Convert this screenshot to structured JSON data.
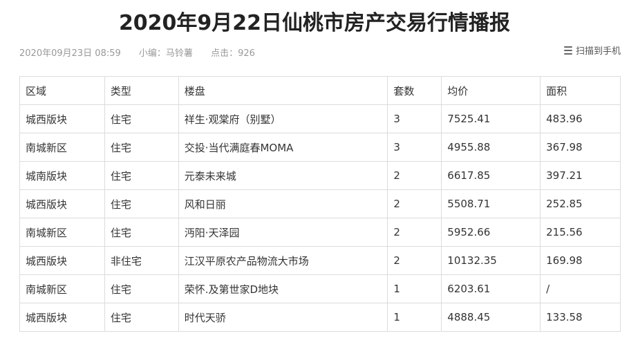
{
  "article": {
    "title": "2020年9月22日仙桃市房产交易行情播报",
    "date": "2020年09月23日 08:59",
    "editor": "小编：马铃薯",
    "clicks": "点击：926",
    "scan_label": "扫描到手机",
    "scan_icon": "qr-scan-icon"
  },
  "table": {
    "headers": [
      "区域",
      "类型",
      "楼盘",
      "套数",
      "均价",
      "面积"
    ],
    "rows": [
      [
        "城西版块",
        "住宅",
        "祥生·观棠府（别墅）",
        "3",
        "7525.41",
        "483.96"
      ],
      [
        "南城新区",
        "住宅",
        "交投·当代满庭春MOMA",
        "3",
        "4955.88",
        "367.98"
      ],
      [
        "城南版块",
        "住宅",
        "元泰未来城",
        "2",
        "6617.85",
        "397.21"
      ],
      [
        "城西版块",
        "住宅",
        "风和日丽",
        "2",
        "5508.71",
        "252.85"
      ],
      [
        "南城新区",
        "住宅",
        "沔阳·天泽园",
        "2",
        "5952.66",
        "215.56"
      ],
      [
        "城西版块",
        "非住宅",
        "江汉平原农产品物流大市场",
        "2",
        "10132.35",
        "169.98"
      ],
      [
        "南城新区",
        "住宅",
        "荣怀.及第世家D地块",
        "1",
        "6203.61",
        "/"
      ],
      [
        "城西版块",
        "住宅",
        "时代天骄",
        "1",
        "4888.45",
        "133.58"
      ]
    ]
  }
}
